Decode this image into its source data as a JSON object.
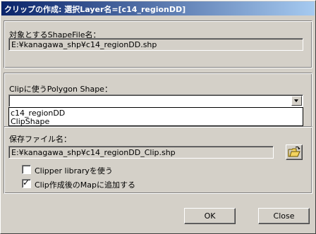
{
  "window": {
    "title": "クリップの作成: 選択Layer名=[c14_regionDD]"
  },
  "target_shape": {
    "label": "対象とするShapeFile名：",
    "value": "E:¥kanagawa_shp¥c14_regionDD.shp"
  },
  "clip_polygon": {
    "label": "Clipに使うPolygon Shape：",
    "selected": "",
    "options": [
      "c14_regionDD",
      "ClipShape"
    ]
  },
  "save_file": {
    "label": "保存ファイル名：",
    "value": "E:¥kanagawa_shp¥c14_regionDD_Clip.shp",
    "folder_icon": "open-folder-icon"
  },
  "options": {
    "clipper_library": {
      "label": "Clipper libraryを使う",
      "checked": false
    },
    "add_to_map": {
      "label": "Clip作成後のMapに追加する",
      "checked": true
    }
  },
  "buttons": {
    "ok": "OK",
    "close": "Close"
  }
}
